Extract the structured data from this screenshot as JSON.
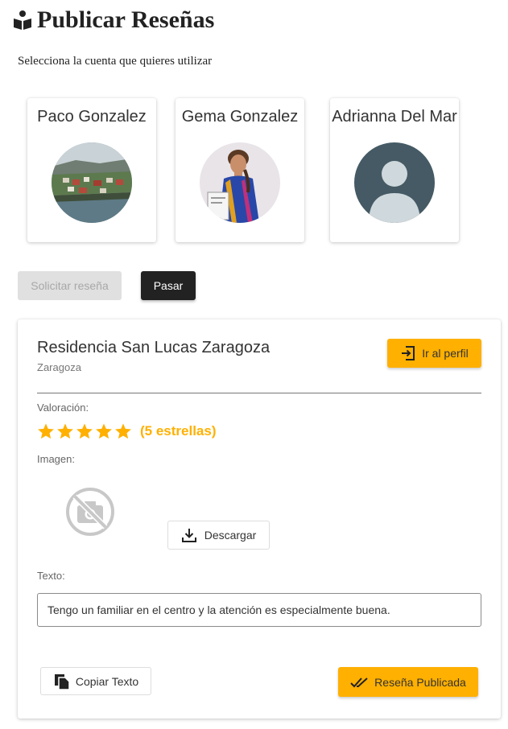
{
  "header": {
    "title": "Publicar Reseñas",
    "icon": "open-book-icon"
  },
  "subtitle": "Selecciona la cuenta que quieres utilizar",
  "accounts": [
    {
      "name": "Paco Gonzalez",
      "avatar": "photo-town-landscape"
    },
    {
      "name": "Gema Gonzalez",
      "avatar": "photo-woman-portrait"
    },
    {
      "name": "Adrianna Del Mar",
      "avatar": "default-user-icon"
    }
  ],
  "actions": {
    "request_review": "Solicitar reseña",
    "pass": "Pasar"
  },
  "business": {
    "name": "Residencia San Lucas Zaragoza",
    "city": "Zaragoza",
    "profile_button": "Ir al perfil"
  },
  "rating": {
    "label": "Valoración:",
    "stars": 5,
    "max_stars": 5,
    "text": "(5 estrellas)",
    "color": "#ffb000"
  },
  "image": {
    "label": "Imagen:",
    "placeholder_icon": "no-photo-icon",
    "download_button": "Descargar"
  },
  "review_text": {
    "label": "Texto:",
    "value": "Tengo un familiar en el centro y la atención es especialmente buena."
  },
  "footer": {
    "copy_button": "Copiar Texto",
    "published_button": "Reseña Publicada"
  },
  "colors": {
    "accent": "#ffb000",
    "dark_button": "#222222",
    "disabled_button": "#e0e0e0"
  }
}
